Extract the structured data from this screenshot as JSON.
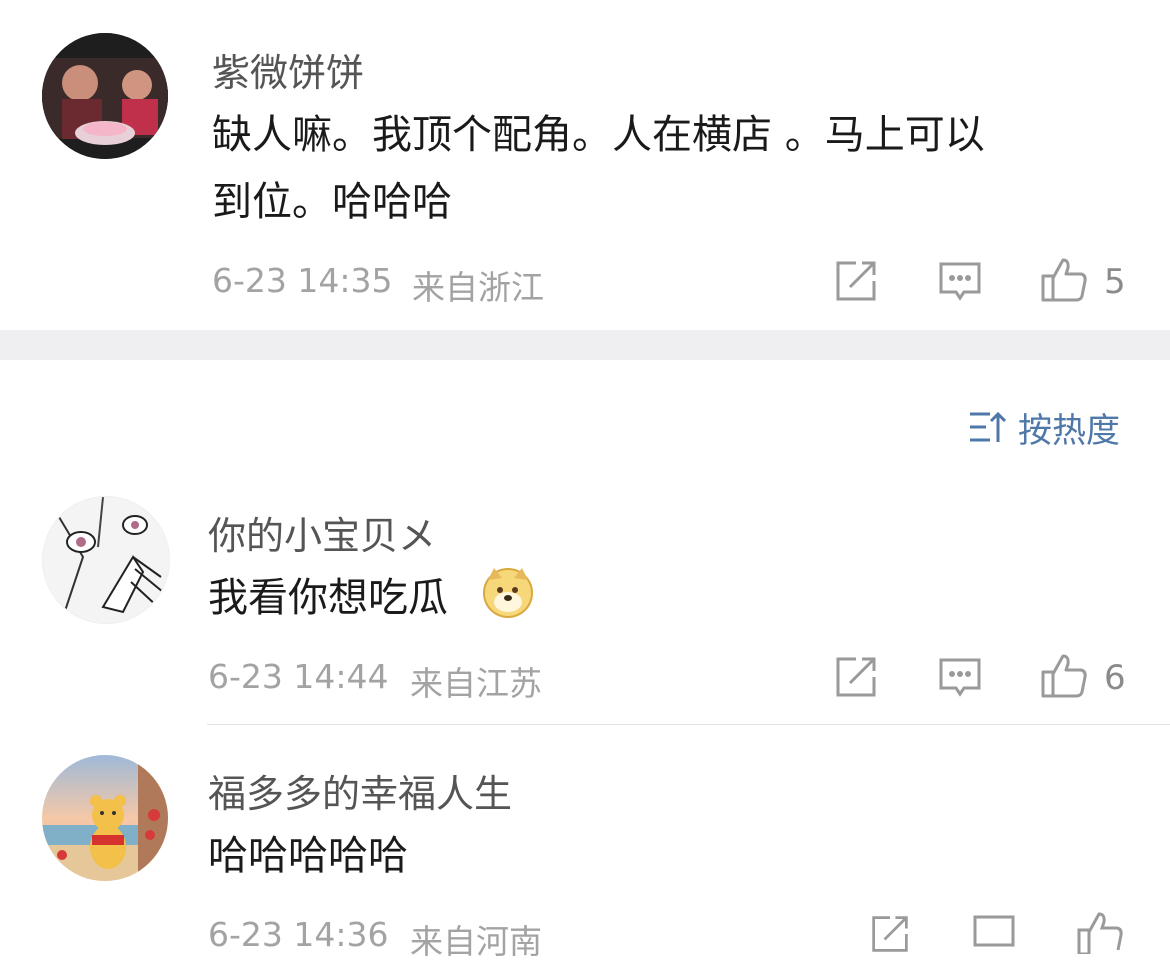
{
  "comments": [
    {
      "username": "紫微饼饼",
      "text_lines": [
        "缺人嘛。我顶个配角。人在横店 。马上可以",
        "到位。哈哈哈"
      ],
      "date": "6-23 14:35",
      "location": "来自浙江",
      "likes": "5"
    },
    {
      "username": "你的小宝贝メ",
      "text_lines": [
        "我看你想吃瓜"
      ],
      "emoji": "doge-emoji",
      "date": "6-23 14:44",
      "location": "来自江苏",
      "likes": "6"
    },
    {
      "username": "福多多的幸福人生",
      "text_lines": [
        "哈哈哈哈哈"
      ],
      "date": "6-23 14:36",
      "location": "来自河南",
      "likes": ""
    }
  ],
  "sort": {
    "label": "按热度",
    "icon": "sort-icon"
  },
  "icons": {
    "share": "share-icon",
    "comment": "comment-icon",
    "like": "thumbs-up-icon"
  },
  "colors": {
    "accent": "#4f78a8",
    "meta": "#a3a3a3",
    "separator": "#efeff1"
  }
}
